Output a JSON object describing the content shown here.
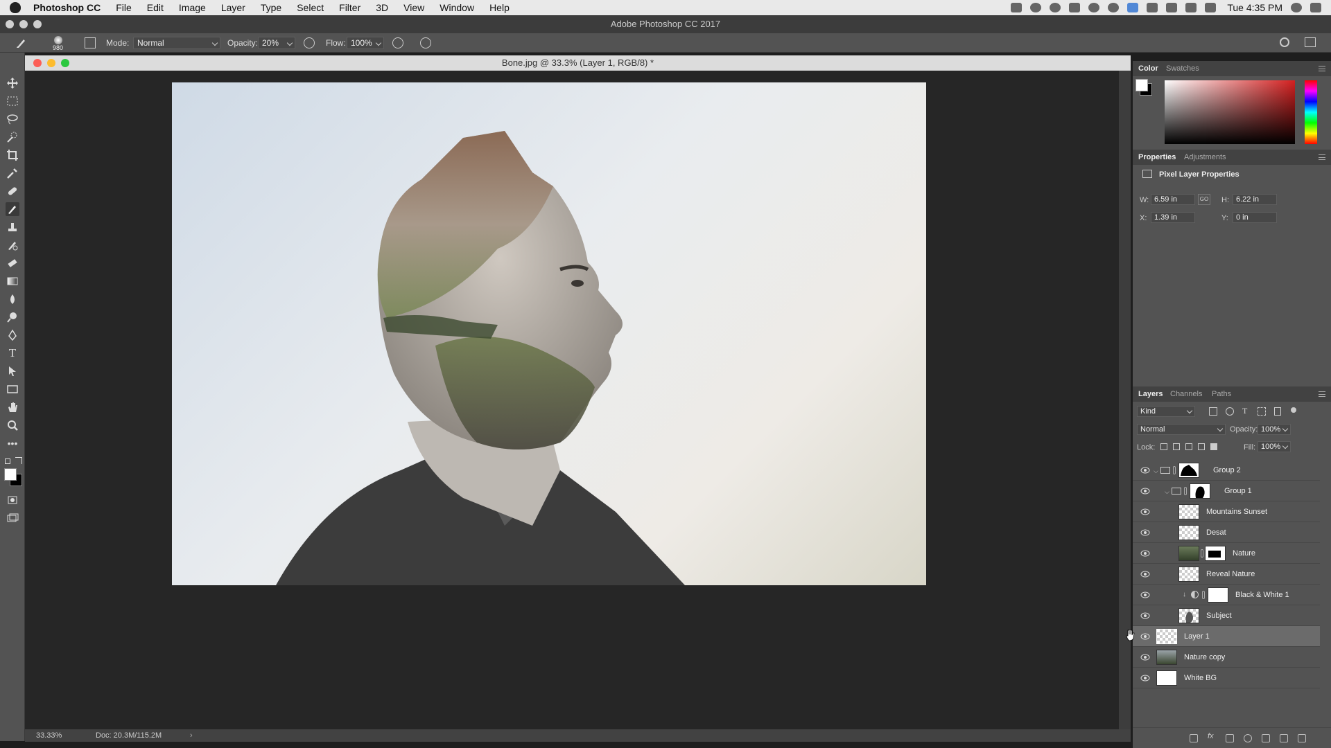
{
  "menubar": {
    "app_name": "Photoshop CC",
    "items": [
      "File",
      "Edit",
      "Image",
      "Layer",
      "Type",
      "Select",
      "Filter",
      "3D",
      "View",
      "Window",
      "Help"
    ],
    "clock": "Tue 4:35 PM"
  },
  "window": {
    "title": "Adobe Photoshop CC 2017"
  },
  "options_bar": {
    "brush_size": "980",
    "mode_label": "Mode:",
    "mode_value": "Normal",
    "opacity_label": "Opacity:",
    "opacity_value": "20%",
    "flow_label": "Flow:",
    "flow_value": "100%"
  },
  "document": {
    "title": "Bone.jpg @ 33.3% (Layer 1, RGB/8) *",
    "zoom": "33.33%",
    "doc_size": "Doc: 20.3M/115.2M"
  },
  "color_panel": {
    "tabs": [
      "Color",
      "Swatches"
    ],
    "accent_hue": "#d42020"
  },
  "properties_panel": {
    "tabs": [
      "Properties",
      "Adjustments"
    ],
    "heading": "Pixel Layer Properties",
    "w_label": "W:",
    "w_value": "6.59 in",
    "h_label": "H:",
    "h_value": "6.22 in",
    "x_label": "X:",
    "x_value": "1.39 in",
    "y_label": "Y:",
    "y_value": "0 in",
    "link_label": "GO"
  },
  "layers_panel": {
    "tabs": [
      "Layers",
      "Channels",
      "Paths"
    ],
    "filter_kind": "Kind",
    "blend_mode": "Normal",
    "opacity_label": "Opacity:",
    "opacity_value": "100%",
    "lock_label": "Lock:",
    "fill_label": "Fill:",
    "fill_value": "100%",
    "layers": [
      {
        "name": "Group 2"
      },
      {
        "name": "Group 1"
      },
      {
        "name": "Mountains Sunset"
      },
      {
        "name": "Desat"
      },
      {
        "name": "Nature"
      },
      {
        "name": "Reveal Nature"
      },
      {
        "name": "Black & White 1"
      },
      {
        "name": "Subject"
      },
      {
        "name": "Layer 1"
      },
      {
        "name": "Nature copy"
      },
      {
        "name": "White BG"
      }
    ]
  }
}
